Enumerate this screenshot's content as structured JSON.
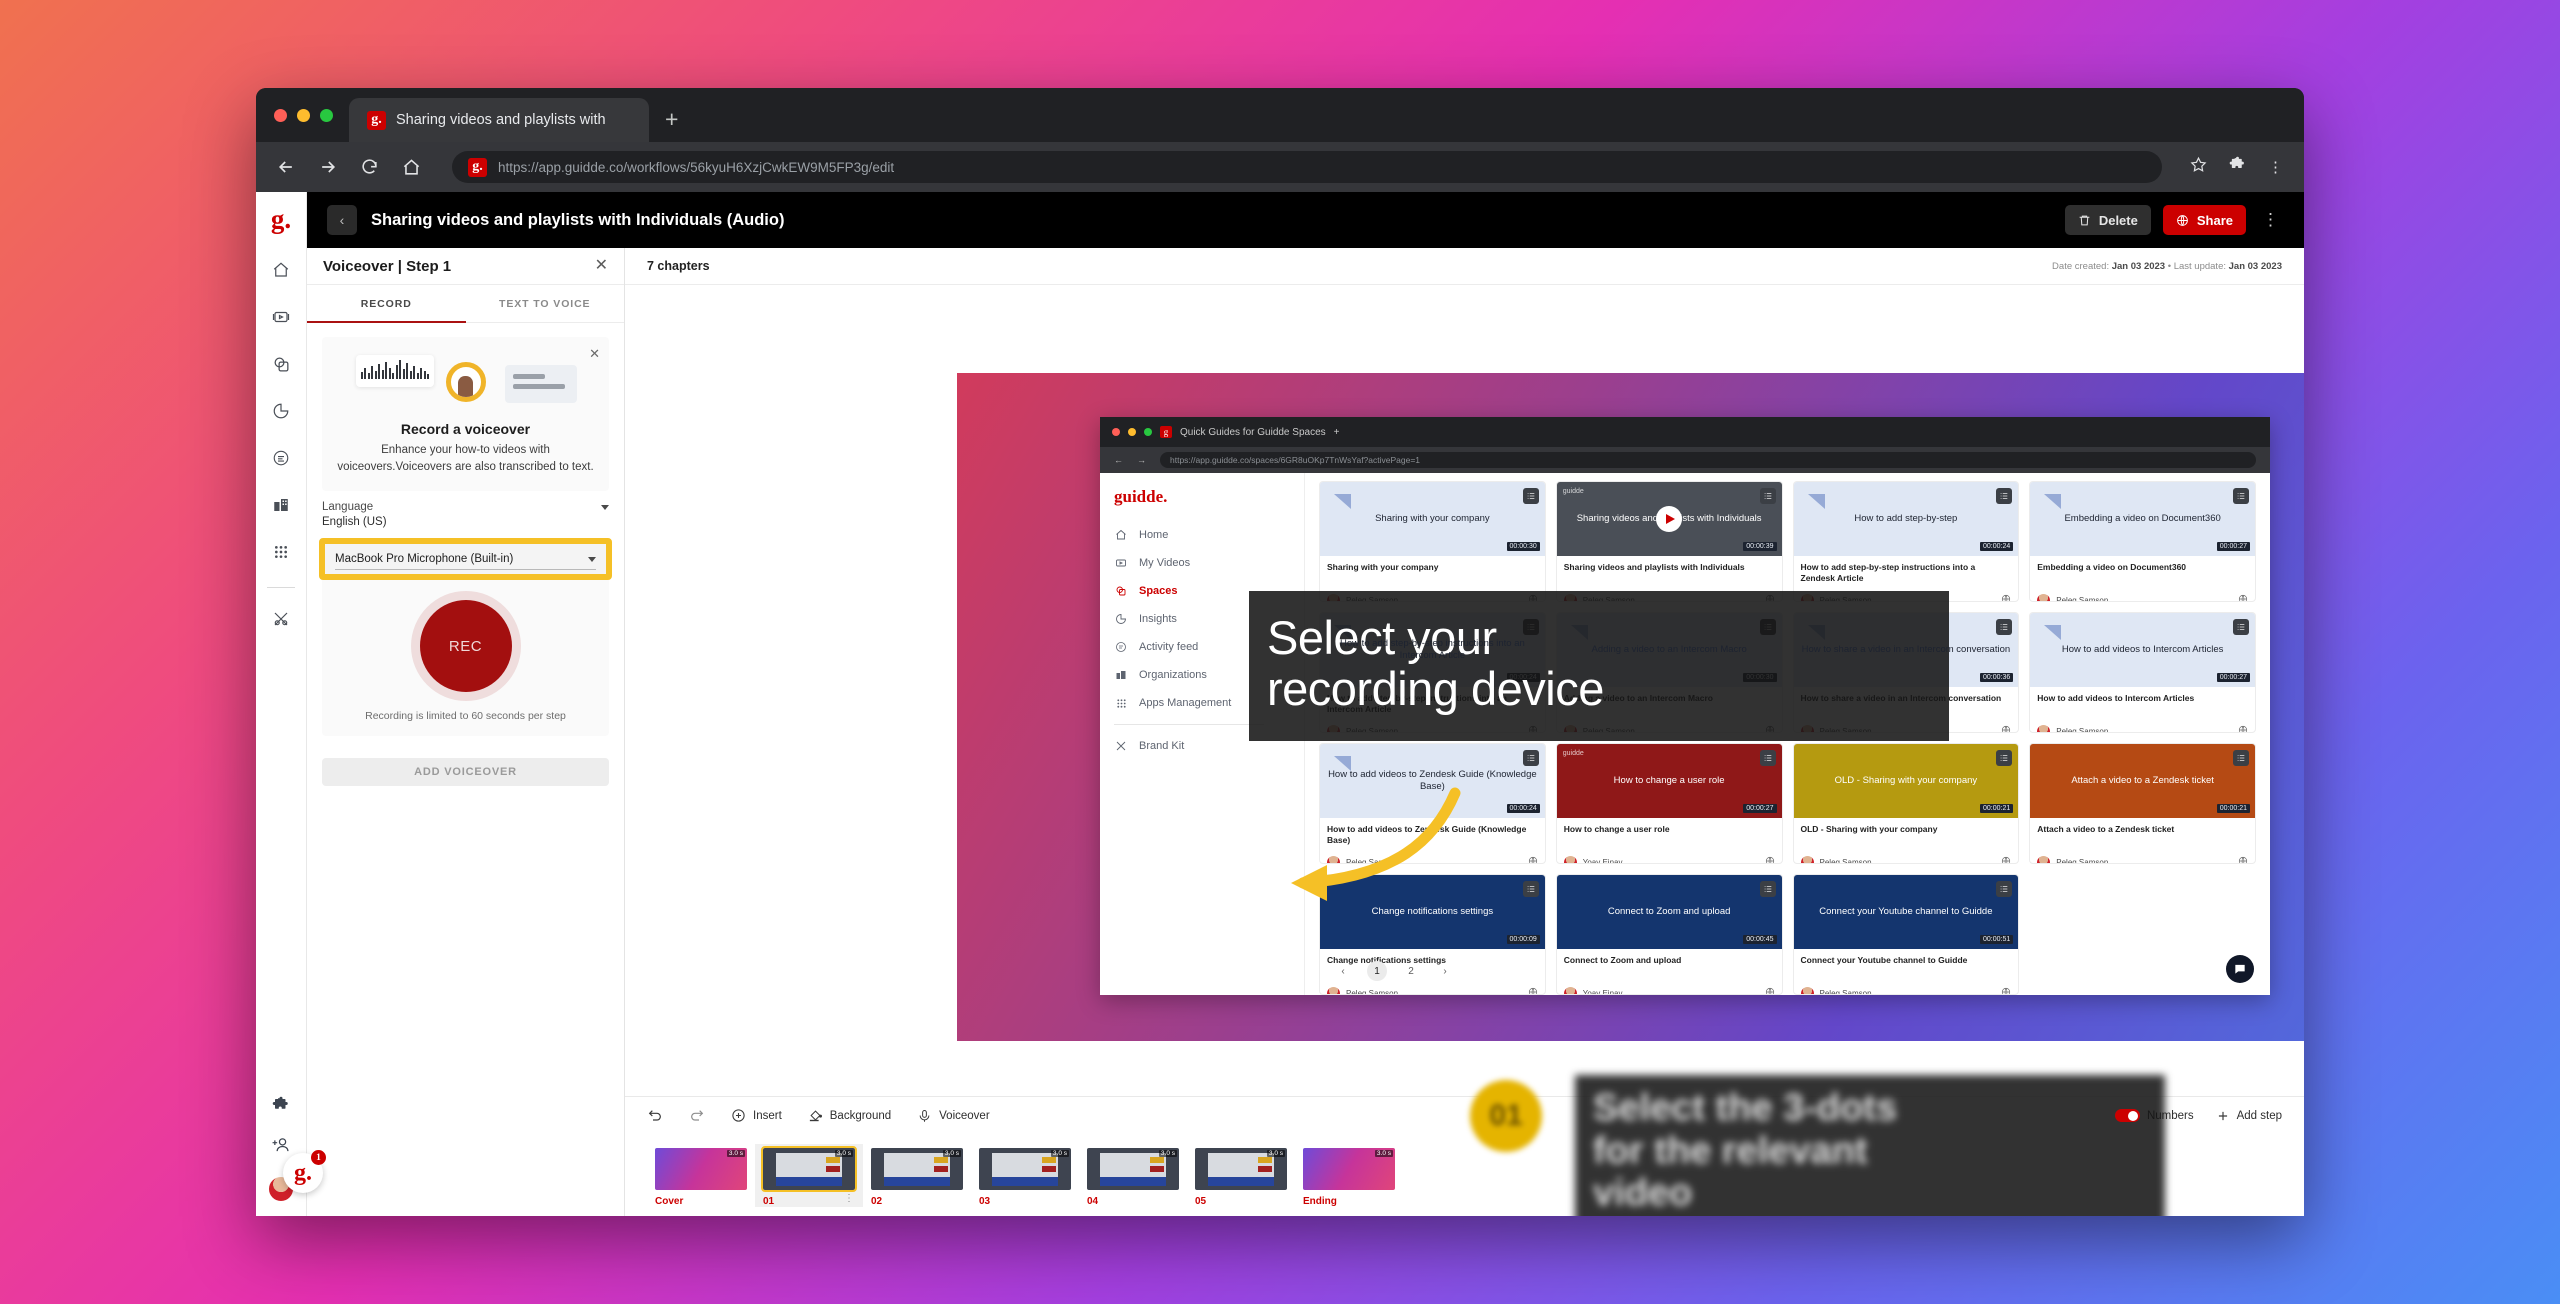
{
  "browser": {
    "tab_title": "Sharing videos and playlists with",
    "new_tab_label": "+",
    "url": "https://app.guidde.co/workflows/56kyuH6XzjCwkEW9M5FP3g/edit",
    "favicon_letter": "g."
  },
  "rail": {
    "logo": "g.",
    "items": [
      {
        "name": "home",
        "label": "Home"
      },
      {
        "name": "my-videos",
        "label": "My Videos"
      },
      {
        "name": "spaces",
        "label": "Spaces"
      },
      {
        "name": "insights",
        "label": "Insights"
      },
      {
        "name": "activity-feed",
        "label": "Activity feed"
      },
      {
        "name": "organizations",
        "label": "Organizations"
      },
      {
        "name": "apps-management",
        "label": "Apps Management"
      },
      {
        "name": "brand-kit",
        "label": "Brand Kit"
      }
    ],
    "notification_count": "1",
    "badge_logo": "g."
  },
  "header": {
    "title": "Sharing videos and playlists with Individuals (Audio)",
    "delete_label": "Delete",
    "share_label": "Share",
    "back_icon": "‹",
    "kebab": "⋮"
  },
  "voiceover_panel": {
    "title": "Voiceover | Step 1",
    "tabs": [
      {
        "label": "RECORD",
        "active": true
      },
      {
        "label": "TEXT TO VOICE",
        "active": false
      }
    ],
    "card_title": "Record a voiceover",
    "card_desc": "Enhance your how-to videos with voiceovers.Voiceovers are also transcribed to text.",
    "language_label": "Language",
    "language_value": "English (US)",
    "mic_value": "MacBook Pro Microphone (Built-in)",
    "rec_label": "REC",
    "rec_limit": "Recording is limited to 60 seconds per step",
    "add_voiceover_label": "ADD VOICEOVER",
    "highlight_color": "#f5c026"
  },
  "chapter_bar": {
    "chapters": "7 chapters",
    "date_created_label": "Date created:",
    "date_created": "Jan 03 2023",
    "separator": "•",
    "last_update_label": "Last update:",
    "last_update": "Jan 03 2023"
  },
  "slide": {
    "caption_line1": "Select your",
    "caption_line2": "recording device",
    "caption2_line1": "Select the 3-dots",
    "caption2_line2": "for the relevant",
    "caption2_line3": "video",
    "badge_number": "01",
    "logo": "g."
  },
  "mini_browser": {
    "tab_title": "Quick Guides for Guidde Spaces",
    "url": "https://app.guidde.co/spaces/6GR8uOKp7TnWsYaf?activePage=1",
    "brand": "guidde.",
    "nav": [
      {
        "label": "Home",
        "icon": "home-icon",
        "active": false
      },
      {
        "label": "My Videos",
        "icon": "video-icon",
        "active": false
      },
      {
        "label": "Spaces",
        "icon": "spaces-icon",
        "active": true
      },
      {
        "label": "Insights",
        "icon": "insights-icon",
        "active": false
      },
      {
        "label": "Activity feed",
        "icon": "activity-icon",
        "active": false
      },
      {
        "label": "Organizations",
        "icon": "org-icon",
        "active": false
      },
      {
        "label": "Apps Management",
        "icon": "apps-icon",
        "active": false
      },
      {
        "label": "Brand Kit",
        "icon": "brand-icon",
        "active": false
      }
    ],
    "cards": [
      {
        "thumb_title": "Sharing with your company",
        "name": "Sharing with your company",
        "author": "Peleg Samson",
        "duration": "00:00:30",
        "style": "light"
      },
      {
        "thumb_title": "Sharing videos and playlists with Individuals",
        "name": "Sharing videos and playlists with Individuals",
        "author": "Peleg Samson",
        "duration": "00:00:39",
        "style": "dark"
      },
      {
        "thumb_title": "How to add step-by-step",
        "name": "How to add step-by-step instructions into a Zendesk Article",
        "author": "Peleg Samson",
        "duration": "00:00:24",
        "style": "light"
      },
      {
        "thumb_title": "Embedding a video on Document360",
        "name": "Embedding a video on Document360",
        "author": "Peleg Samson",
        "duration": "00:00:27",
        "style": "light"
      },
      {
        "thumb_title": "How to add step-by-step instructions into an Intercom Article",
        "name": "How to add step-by-step instructions into an Intercom Article",
        "author": "Peleg Samson",
        "duration": "00:00:24",
        "style": "light"
      },
      {
        "thumb_title": "Adding a video to an Intercom Macro",
        "name": "Adding a video to an Intercom Macro",
        "author": "Peleg Samson",
        "duration": "00:00:30",
        "style": "light"
      },
      {
        "thumb_title": "How to share a video in an Intercom conversation",
        "name": "How to share a video in an Intercom conversation",
        "author": "Peleg Samson",
        "duration": "00:00:36",
        "style": "light"
      },
      {
        "thumb_title": "How to add videos to Intercom Articles",
        "name": "How to add videos to Intercom Articles",
        "author": "Peleg Samson",
        "duration": "00:00:27",
        "style": "light"
      },
      {
        "thumb_title": "How to add videos to Zendesk Guide (Knowledge Base)",
        "name": "How to add videos to Zendesk Guide (Knowledge Base)",
        "author": "Peleg Samson",
        "duration": "00:00:24",
        "style": "light"
      },
      {
        "thumb_title": "How to change a user role",
        "name": "How to change a user role",
        "author": "Yoav Einav",
        "duration": "00:00:27",
        "style": "red"
      },
      {
        "thumb_title": "OLD - Sharing with your company",
        "name": "OLD - Sharing with your company",
        "author": "Peleg Samson",
        "duration": "00:00:21",
        "style": "gold"
      },
      {
        "thumb_title": "Attach a video to a Zendesk ticket",
        "name": "Attach a video to a Zendesk ticket",
        "author": "Peleg Samson",
        "duration": "00:00:21",
        "style": "orange"
      },
      {
        "thumb_title": "Change notifications settings",
        "name": "Change notifications settings",
        "author": "Peleg Samson",
        "duration": "00:00:09",
        "style": "navy"
      },
      {
        "thumb_title": "Connect to Zoom and upload",
        "name": "Connect to Zoom and upload",
        "author": "Yoav Einav",
        "duration": "00:00:45",
        "style": "navy"
      },
      {
        "thumb_title": "Connect your Youtube channel to Guidde",
        "name": "Connect your Youtube channel to Guidde",
        "author": "Peleg Samson",
        "duration": "00:00:51",
        "style": "navy"
      }
    ],
    "pagination": {
      "prev": "‹",
      "pages": [
        "1",
        "2"
      ],
      "next": "›",
      "current": "1"
    }
  },
  "toolbar": {
    "undo": "undo-icon",
    "redo": "redo-icon",
    "insert_label": "Insert",
    "background_label": "Background",
    "voiceover_label": "Voiceover",
    "numbers_label": "Numbers",
    "numbers_on": true,
    "add_step_label": "Add step"
  },
  "filmstrip": [
    {
      "label": "Cover",
      "duration": "3.0 s",
      "selected": false,
      "style": "cover"
    },
    {
      "label": "01",
      "duration": "3.0 s",
      "selected": true,
      "style": "shot"
    },
    {
      "label": "02",
      "duration": "3.0 s",
      "selected": false,
      "style": "shot"
    },
    {
      "label": "03",
      "duration": "3.0 s",
      "selected": false,
      "style": "shot"
    },
    {
      "label": "04",
      "duration": "3.0 s",
      "selected": false,
      "style": "shot"
    },
    {
      "label": "05",
      "duration": "3.0 s",
      "selected": false,
      "style": "shot"
    },
    {
      "label": "Ending",
      "duration": "3.0 s",
      "selected": false,
      "style": "cover"
    }
  ]
}
